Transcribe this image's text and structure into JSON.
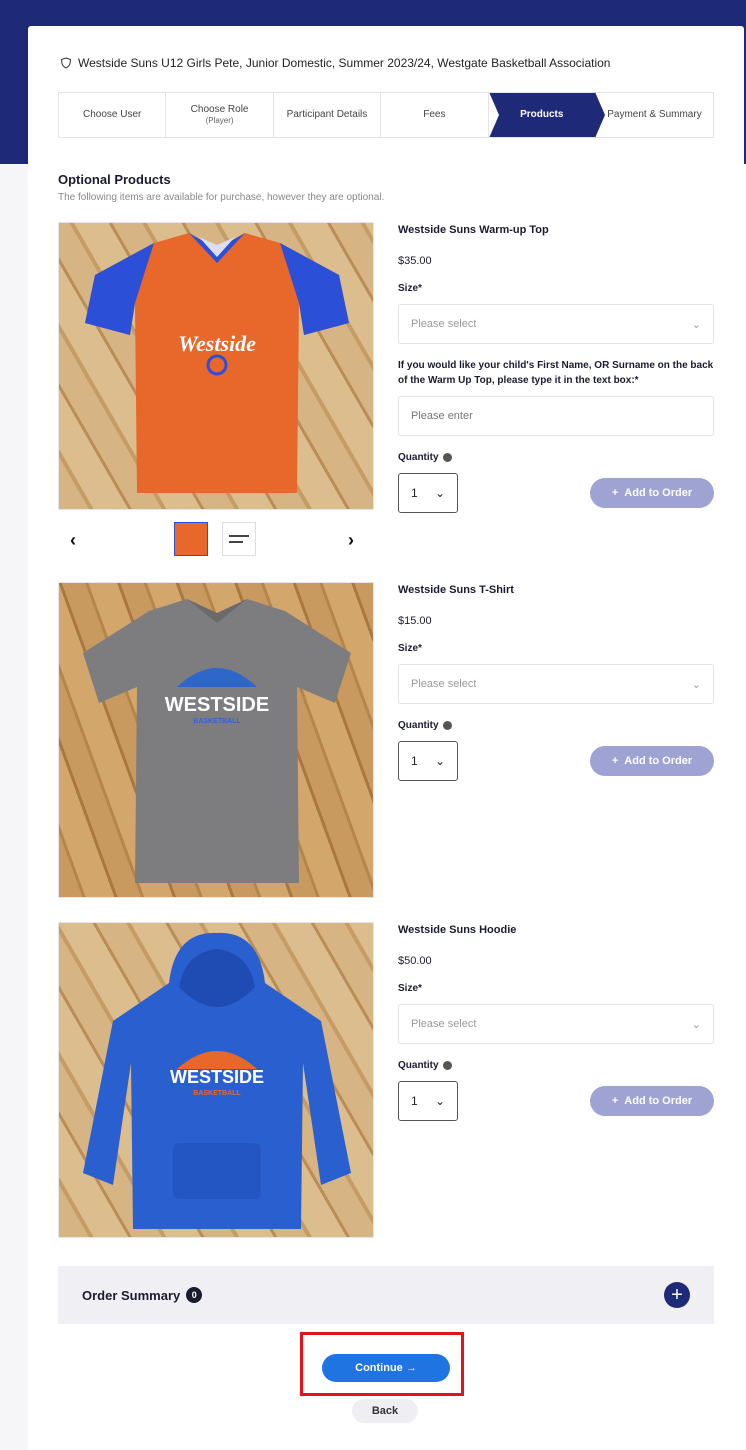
{
  "event": {
    "title": "Westside Suns U12 Girls Pete, Junior Domestic, Summer 2023/24, Westgate Basketball Association"
  },
  "steps": [
    {
      "label": "Choose User",
      "sub": ""
    },
    {
      "label": "Choose Role",
      "sub": "(Player)"
    },
    {
      "label": "Participant Details",
      "sub": ""
    },
    {
      "label": "Fees",
      "sub": ""
    },
    {
      "label": "Products",
      "sub": ""
    },
    {
      "label": "Payment & Summary",
      "sub": ""
    }
  ],
  "section": {
    "title": "Optional Products",
    "description": "The following items are available for purchase, however they are optional."
  },
  "products": [
    {
      "name": "Westside Suns Warm-up Top",
      "price": "$35.00",
      "size_label": "Size*",
      "size_placeholder": "Please select",
      "text_label": "If you would like your child's First Name, OR Surname on the back of the Warm Up Top, please type it in the text box:*",
      "text_placeholder": "Please enter",
      "quantity_label": "Quantity",
      "quantity_value": "1",
      "add_label": "Add to Order",
      "image_text": "Westside"
    },
    {
      "name": "Westside Suns T-Shirt",
      "price": "$15.00",
      "size_label": "Size*",
      "size_placeholder": "Please select",
      "quantity_label": "Quantity",
      "quantity_value": "1",
      "add_label": "Add to Order",
      "image_text": "WESTSIDE",
      "image_subtext": "BASKETBALL"
    },
    {
      "name": "Westside Suns Hoodie",
      "price": "$50.00",
      "size_label": "Size*",
      "size_placeholder": "Please select",
      "quantity_label": "Quantity",
      "quantity_value": "1",
      "add_label": "Add to Order",
      "image_text": "WESTSIDE",
      "image_subtext": "BASKETBALL"
    }
  ],
  "gallery": {
    "prev": "‹",
    "next": "›"
  },
  "order_summary": {
    "label": "Order Summary",
    "count": "0",
    "expand": "+"
  },
  "actions": {
    "continue_label": "Continue →",
    "back_label": "Back"
  },
  "colors": {
    "brand": "#1e2a78",
    "primary_button": "#1f74e2",
    "add_button": "#9ea3d3",
    "highlight": "#e1141e"
  }
}
